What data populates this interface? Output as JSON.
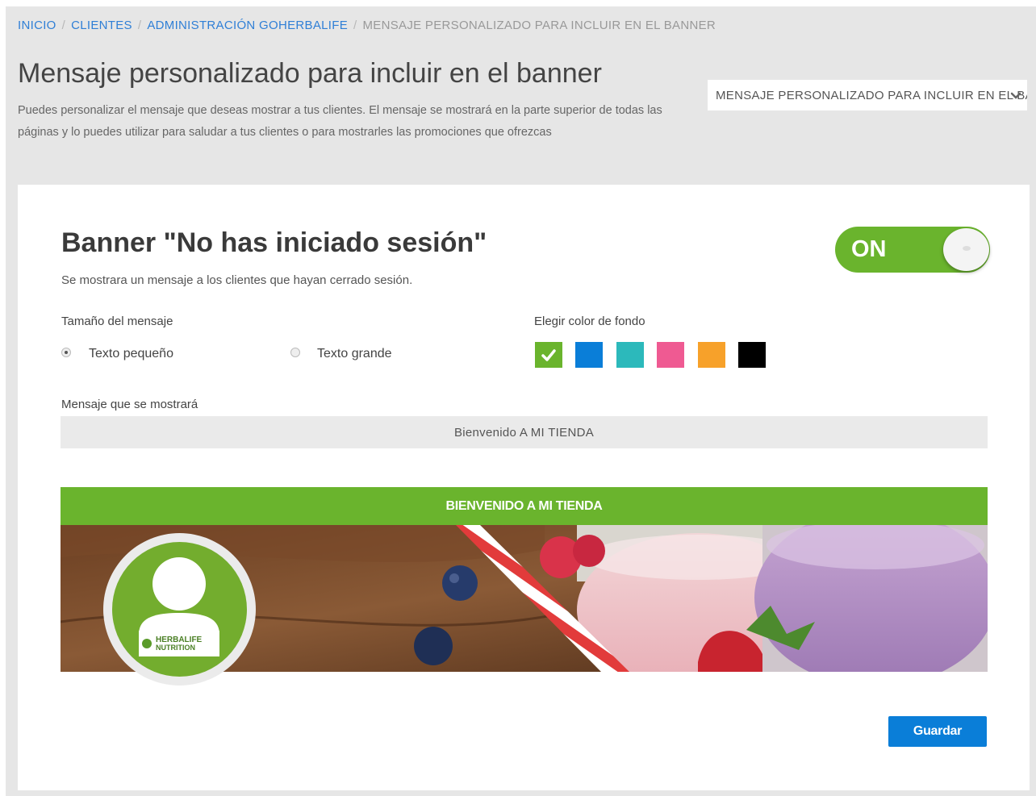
{
  "breadcrumb": {
    "items": [
      "INICIO",
      "CLIENTES",
      "ADMINISTRACIÓN GOHERBALIFE"
    ],
    "separator": "/",
    "current": "MENSAJE PERSONALIZADO PARA INCLUIR EN EL BANNER"
  },
  "header": {
    "title": "Mensaje personalizado para incluir en el banner",
    "description": "Puedes personalizar el mensaje que deseas mostrar a tus clientes. El mensaje se mostrará en la parte superior de todas las páginas y lo puedes utilizar para saludar a tus clientes o para mostrarles las promociones que ofrezcas",
    "section_select": "MENSAJE PERSONALIZADO PARA INCLUIR EN EL BANNER",
    "section_select_icon": "chevron-down-icon"
  },
  "banner": {
    "title": "Banner \"No has iniciado sesión\"",
    "subtitle": "Se mostrara un mensaje a los clientes que hayan cerrado sesión.",
    "toggle": {
      "label": "ON",
      "state": "on",
      "color": "#6ab42d"
    },
    "size": {
      "label": "Tamaño del mensaje",
      "options": [
        {
          "label": "Texto pequeño",
          "selected": true
        },
        {
          "label": "Texto grande",
          "selected": false
        }
      ]
    },
    "colors": {
      "label": "Elegir color de fondo",
      "swatches": [
        {
          "name": "green",
          "hex": "#6ab42d",
          "selected": true
        },
        {
          "name": "blue",
          "hex": "#0a7ed8",
          "selected": false
        },
        {
          "name": "teal",
          "hex": "#2cb9bb",
          "selected": false
        },
        {
          "name": "pink",
          "hex": "#ef5a92",
          "selected": false
        },
        {
          "name": "orange",
          "hex": "#f7a12a",
          "selected": false
        },
        {
          "name": "black",
          "hex": "#000000",
          "selected": false
        }
      ]
    },
    "message": {
      "label": "Mensaje que se mostrará",
      "value": "Bienvenido A MI TIENDA"
    },
    "preview": {
      "bar_text": "BIENVENIDO A MI TIENDA",
      "avatar_logo_text": [
        "HERBALIFE",
        "NUTRITION"
      ]
    },
    "save_label": "Guardar"
  }
}
